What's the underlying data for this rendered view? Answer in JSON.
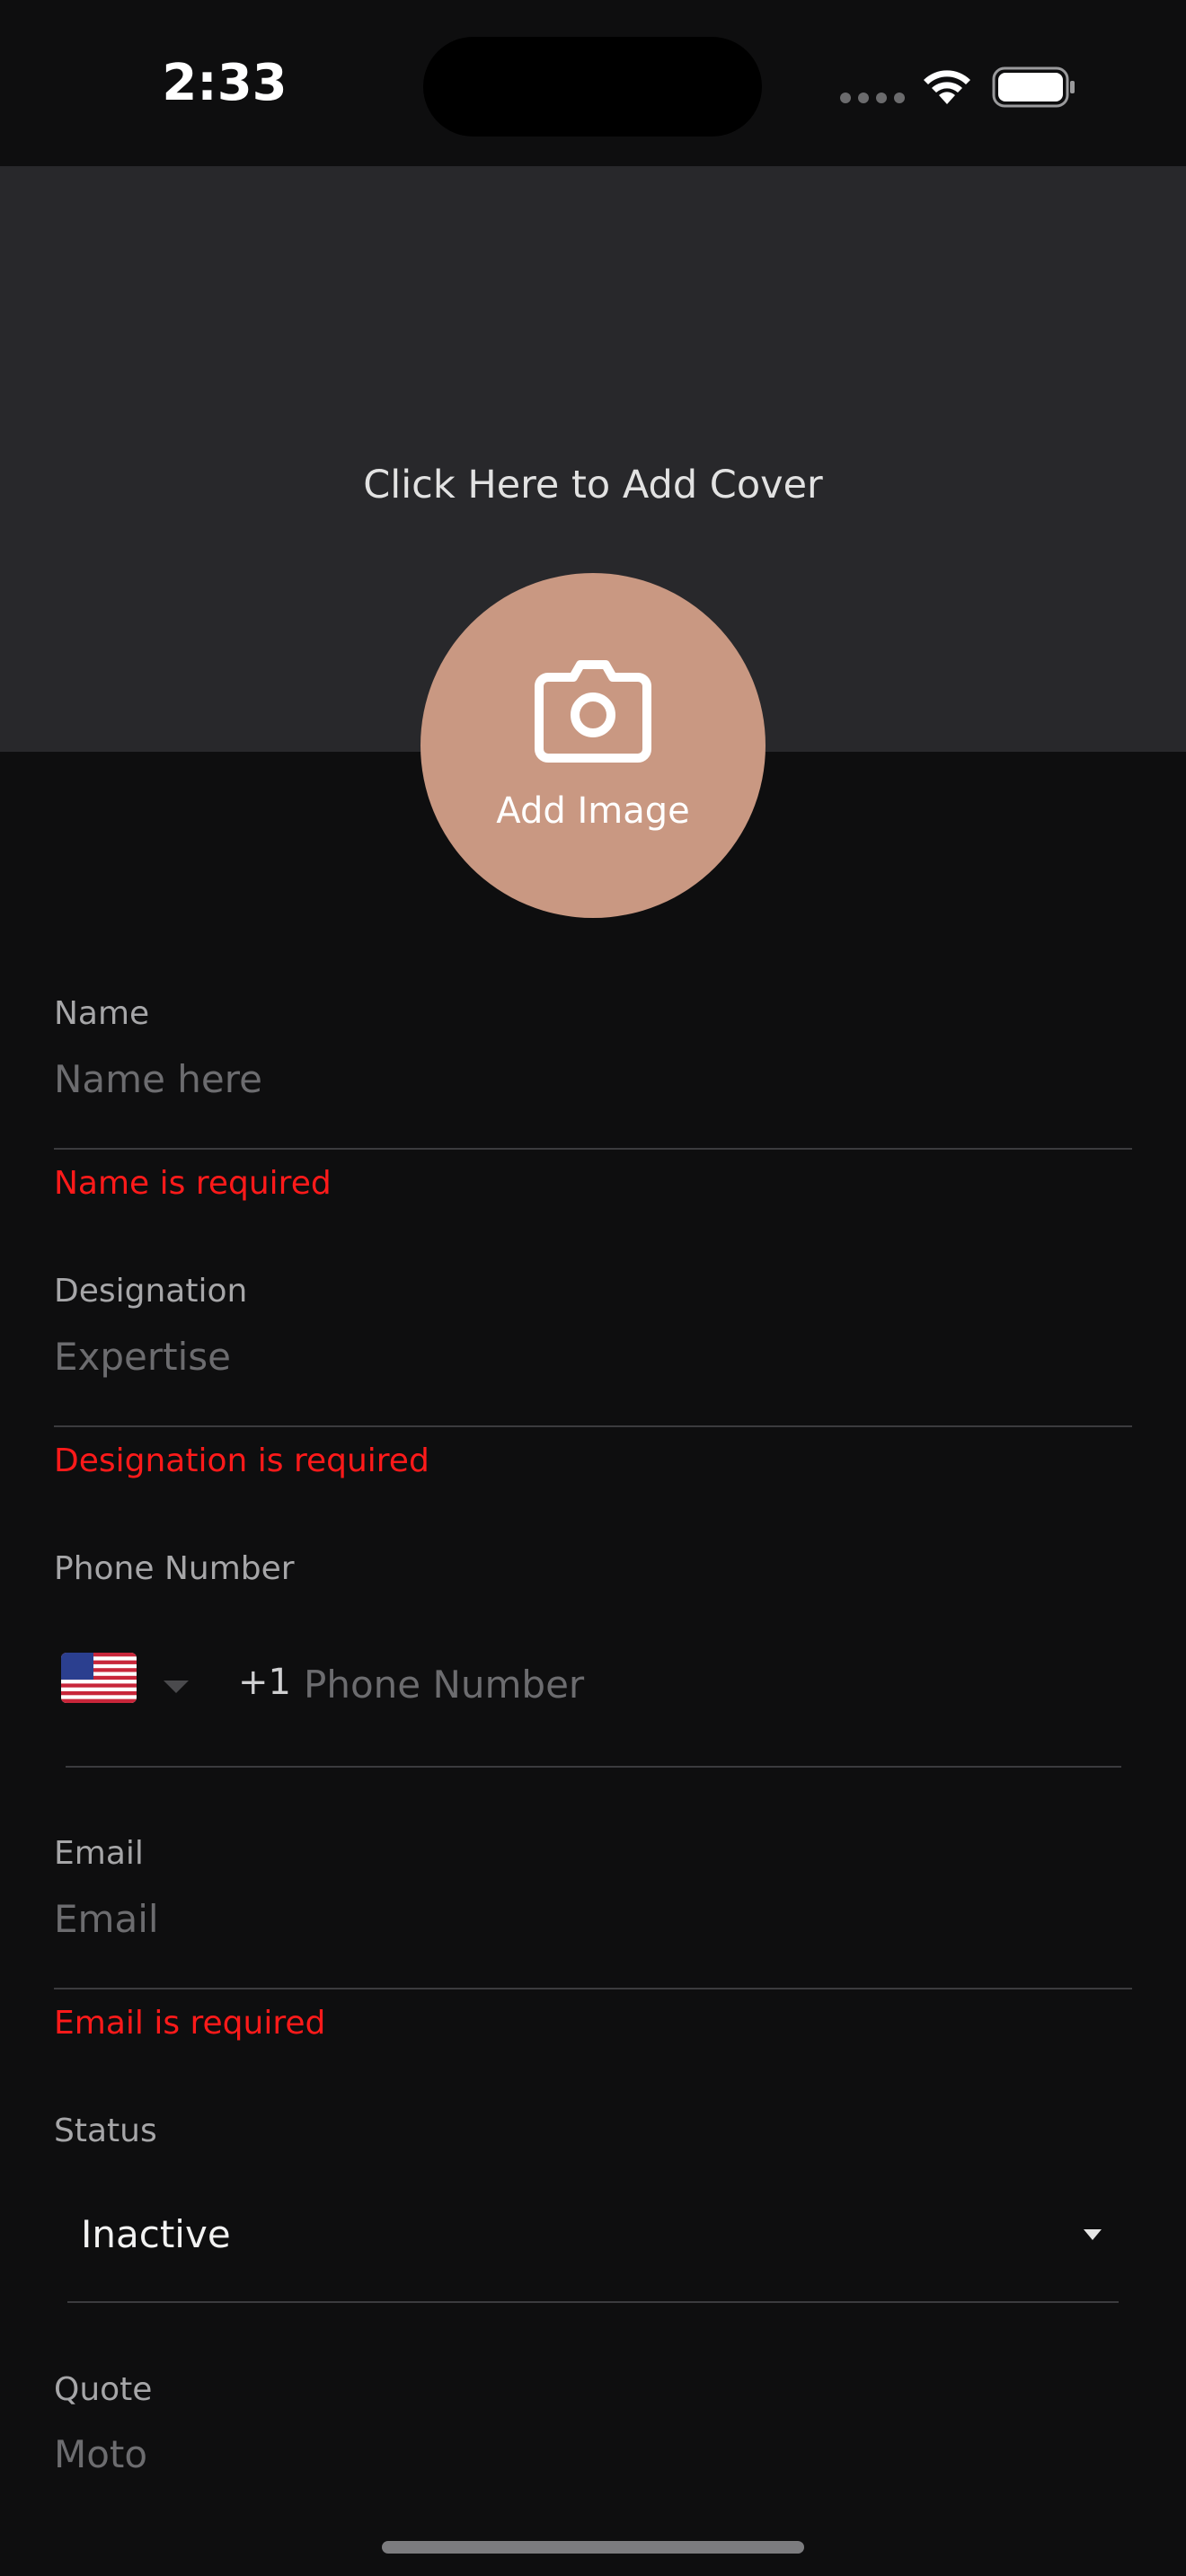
{
  "status_bar": {
    "time": "2:33"
  },
  "cover": {
    "prompt": "Click Here to Add Cover"
  },
  "avatar": {
    "label": "Add Image"
  },
  "form": {
    "name": {
      "label": "Name",
      "placeholder": "Name here",
      "error": "Name is required"
    },
    "designation": {
      "label": "Designation",
      "placeholder": "Expertise",
      "error": "Designation is required"
    },
    "phone": {
      "label": "Phone Number",
      "country_flag": "🇺🇸",
      "dial_code": "+1",
      "placeholder": "Phone Number"
    },
    "email": {
      "label": "Email",
      "placeholder": "Email",
      "error": "Email is required"
    },
    "status": {
      "label": "Status",
      "selected": "Inactive"
    },
    "quote": {
      "label": "Quote",
      "placeholder": "Moto"
    }
  },
  "colors": {
    "background": "#0e0e0f",
    "cover": "#28282b",
    "avatar": "#c99882",
    "error": "#ff1a1a"
  }
}
